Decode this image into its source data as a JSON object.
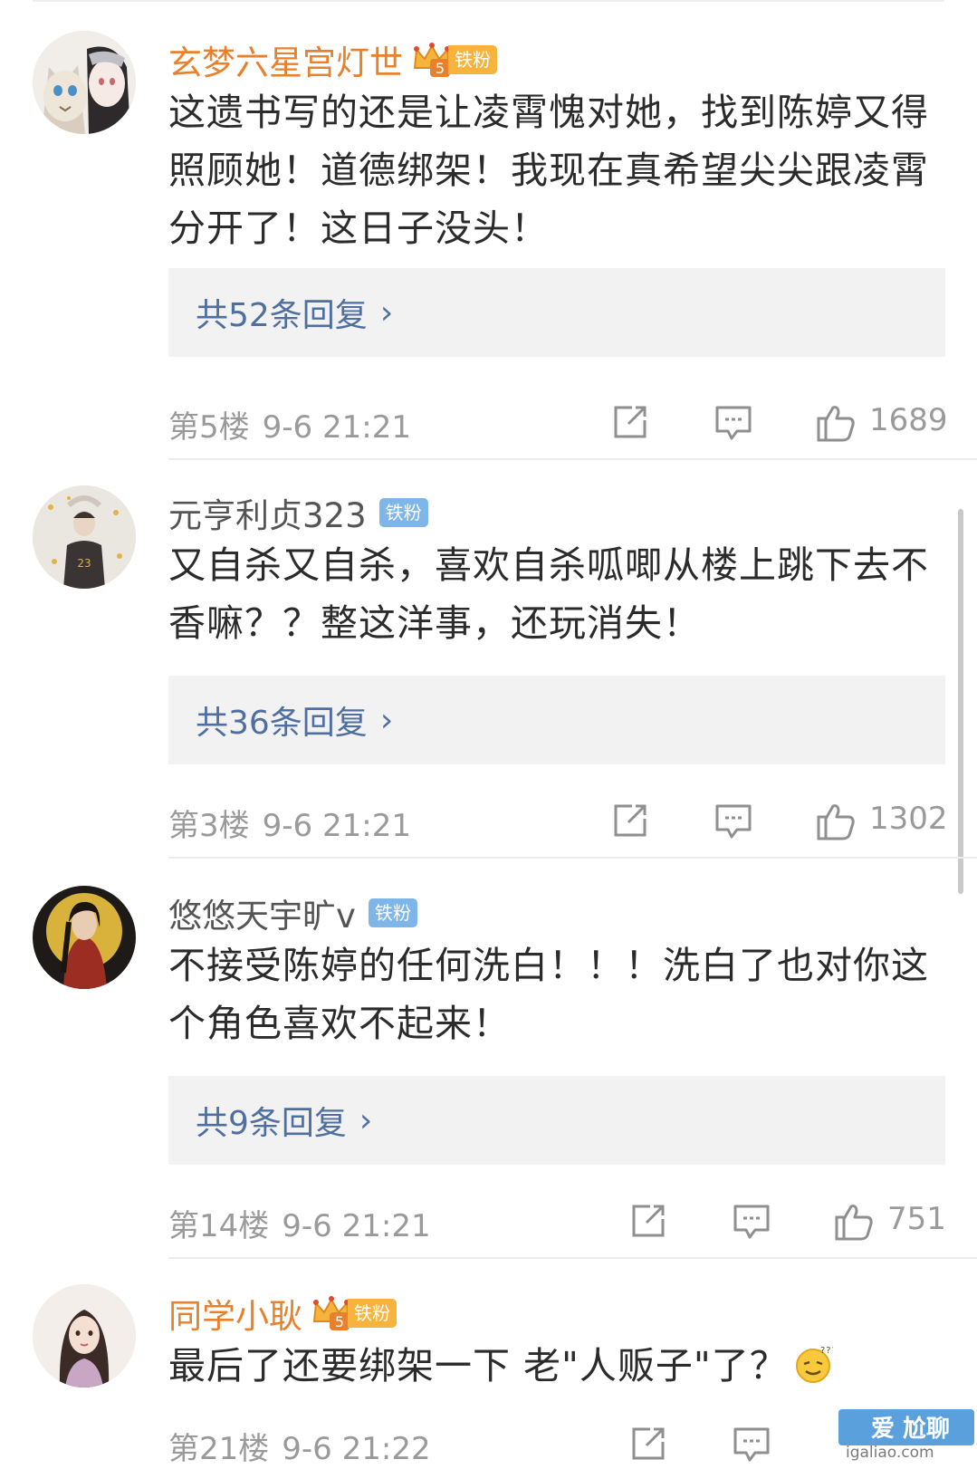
{
  "comments": [
    {
      "username": "玄梦六星宫灯世",
      "badge": "铁粉",
      "text": "这遗书写的还是让凌霄愧对她，找到陈婷又得照顾她！道德绑架！我现在真希望尖尖跟凌霄分开了！这日子没头！",
      "replies": "共52条回复",
      "floor": "第5楼",
      "time": "9-6 21:21",
      "likes": "1689"
    },
    {
      "username": "元亨利贞323",
      "badge": "铁粉",
      "text": "又自杀又自杀，喜欢自杀呱唧从楼上跳下去不香嘛？？整这洋事，还玩消失！",
      "replies": "共36条回复",
      "floor": "第3楼",
      "time": "9-6 21:21",
      "likes": "1302"
    },
    {
      "username": "悠悠天宇旷v",
      "badge": "铁粉",
      "text": "不接受陈婷的任何洗白！！！洗白了也对你这个角色喜欢不起来！",
      "replies": "共9条回复",
      "floor": "第14楼",
      "time": "9-6 21:21",
      "likes": "751"
    },
    {
      "username": "同学小耿",
      "badge": "铁粉",
      "text": "最后了还要绑架一下  老\"人贩子\"了？",
      "floor": "第21楼",
      "time": "9-6 21:22"
    }
  ],
  "reply_chevron": "›",
  "crown_level": "5",
  "watermark": {
    "title": "爱 尬聊",
    "site": "igaliao.com"
  },
  "colors": {
    "vip_name": "#e8802c",
    "normal_name": "#555555",
    "reply_link": "#4f6fa0",
    "fan_badge_blue": "#7eb6ea",
    "fan_badge_gold": "#f6b33d",
    "meta_gray": "#9a9a9a"
  },
  "icons": [
    "share-icon",
    "comment-icon",
    "thumbs-up-icon",
    "crown-icon",
    "squint-emoji"
  ]
}
